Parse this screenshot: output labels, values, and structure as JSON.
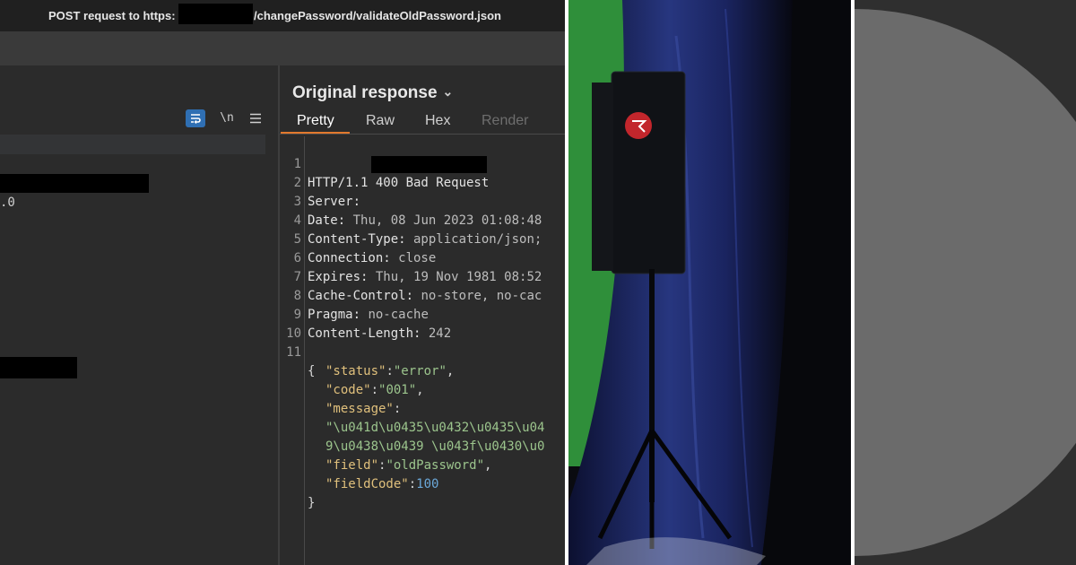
{
  "window": {
    "title_prefix": "POST request to https:",
    "title_suffix": "/changePassword/validateOldPassword.json"
  },
  "left_pane": {
    "toolbar": {
      "wrap_icon": "word-wrap-icon",
      "newline_label": "\\n",
      "menu_icon": "hamburger-menu-icon"
    },
    "visible_fragment": ".0"
  },
  "response": {
    "header": "Original response",
    "tabs": [
      {
        "label": "Pretty",
        "state": "active"
      },
      {
        "label": "Raw",
        "state": "normal"
      },
      {
        "label": "Hex",
        "state": "normal"
      },
      {
        "label": "Render",
        "state": "disabled"
      }
    ],
    "headers": [
      {
        "line": "1",
        "key": "HTTP/1.1 400 Bad Request",
        "value": ""
      },
      {
        "line": "2",
        "key": "Server:",
        "value": ""
      },
      {
        "line": "3",
        "key": "Date:",
        "value": " Thu, 08 Jun 2023 01:08:48"
      },
      {
        "line": "4",
        "key": "Content-Type:",
        "value": " application/json;"
      },
      {
        "line": "5",
        "key": "Connection:",
        "value": " close"
      },
      {
        "line": "6",
        "key": "Expires:",
        "value": " Thu, 19 Nov 1981 08:52"
      },
      {
        "line": "7",
        "key": "Cache-Control:",
        "value": " no-store, no-cac"
      },
      {
        "line": "8",
        "key": "Pragma:",
        "value": " no-cache"
      },
      {
        "line": "9",
        "key": "Content-Length:",
        "value": " 242"
      },
      {
        "line": "10",
        "key": "",
        "value": ""
      }
    ],
    "body_line_no": "11",
    "body": {
      "open": "{",
      "status_key": "\"status\"",
      "status_val": "\"error\"",
      "code_key": "\"code\"",
      "code_val": "\"001\"",
      "message_key": "\"message\"",
      "message_l1": "\"\\u041d\\u0435\\u0432\\u0435\\u04",
      "message_l2": "9\\u0438\\u0439 \\u043f\\u0430\\u0",
      "field_key": "\"field\"",
      "field_val": "\"oldPassword\"",
      "fieldcode_key": "\"fieldCode\"",
      "fieldcode_val": "100",
      "close": "}"
    }
  },
  "colors": {
    "accent_tab": "#e2792d",
    "json_key": "#e0c07c",
    "json_string": "#9cc58d",
    "json_number": "#6ba8d9",
    "green_screen": "#2f8f3a",
    "blue_drape": "#1d2a6b",
    "disc_grey": "#6b6b6b"
  }
}
